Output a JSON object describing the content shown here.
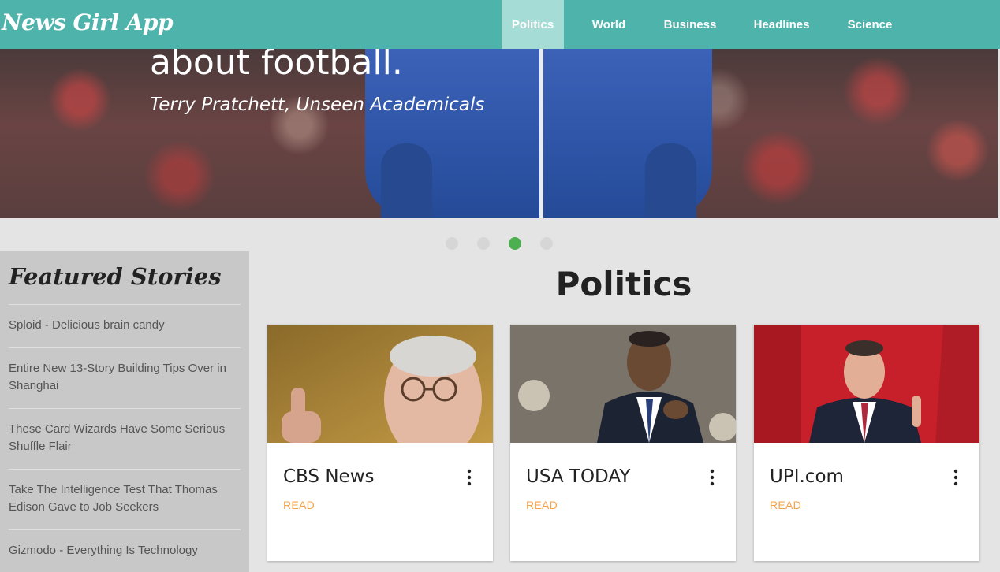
{
  "app": {
    "brand": "News Girl App"
  },
  "nav": {
    "items": [
      {
        "label": "Politics",
        "active": true
      },
      {
        "label": "World",
        "active": false
      },
      {
        "label": "Business",
        "active": false
      },
      {
        "label": "Headlines",
        "active": false
      },
      {
        "label": "Science",
        "active": false
      }
    ]
  },
  "hero": {
    "quote": "about football.",
    "citation": "Terry Pratchett, Unseen Academicals",
    "slides": 4,
    "active_slide": 3
  },
  "sidebar": {
    "title": "Featured Stories",
    "items": [
      {
        "label": "Sploid - Delicious brain candy"
      },
      {
        "label": "Entire New 13-Story Building Tips Over in Shanghai"
      },
      {
        "label": "These Card Wizards Have Some Serious Shuffle Flair"
      },
      {
        "label": "Take The Intelligence Test That Thomas Edison Gave to Job Seekers"
      },
      {
        "label": "Gizmodo - Everything Is Technology"
      }
    ]
  },
  "main": {
    "section_title": "Politics",
    "cards": [
      {
        "title": "CBS News",
        "action": "READ"
      },
      {
        "title": "USA TODAY",
        "action": "READ"
      },
      {
        "title": "UPI.com",
        "action": "READ"
      }
    ]
  },
  "colors": {
    "nav_bg": "#4db3ab",
    "nav_active_bg": "#a6dcd6",
    "dot_active": "#4caf50",
    "read_link": "#f5a34a",
    "sidebar_bg": "#c8c8c8",
    "page_bg": "#e4e4e4"
  }
}
